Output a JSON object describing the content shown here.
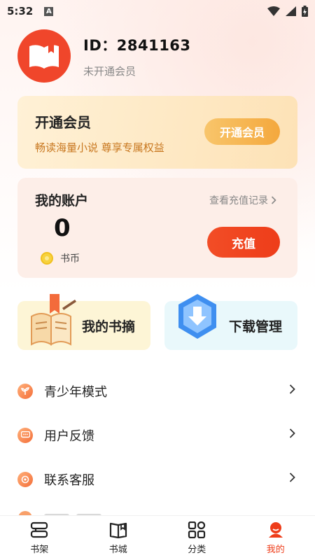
{
  "status_bar": {
    "time": "5:32",
    "notif_glyph": "A"
  },
  "profile": {
    "id_text": "ID：2841163",
    "member_status": "未开通会员"
  },
  "vip": {
    "title": "开通会员",
    "subtitle": "畅读海量小说 尊享专属权益",
    "button": "开通会员"
  },
  "account": {
    "title": "我的账户",
    "record_link": "查看充值记录",
    "balance": "0",
    "coin_label": "书币",
    "recharge_button": "充值"
  },
  "tiles": {
    "excerpts": "我的书摘",
    "downloads": "下载管理"
  },
  "menu": [
    {
      "label": "青少年模式",
      "icon": "sprout-icon"
    },
    {
      "label": "用户反馈",
      "icon": "chat-icon"
    },
    {
      "label": "联系客服",
      "icon": "service-icon"
    }
  ],
  "tabbar": [
    {
      "label": "书架",
      "icon": "bookshelf-icon",
      "active": false
    },
    {
      "label": "书城",
      "icon": "book-open-icon",
      "active": false
    },
    {
      "label": "分类",
      "icon": "category-grid-icon",
      "active": false
    },
    {
      "label": "我的",
      "icon": "profile-icon",
      "active": true
    }
  ],
  "colors": {
    "accent": "#ee3d1a",
    "vip_text": "#c8771f",
    "vip_button": "#f4a83d",
    "account_bg": "#fdeee8"
  }
}
